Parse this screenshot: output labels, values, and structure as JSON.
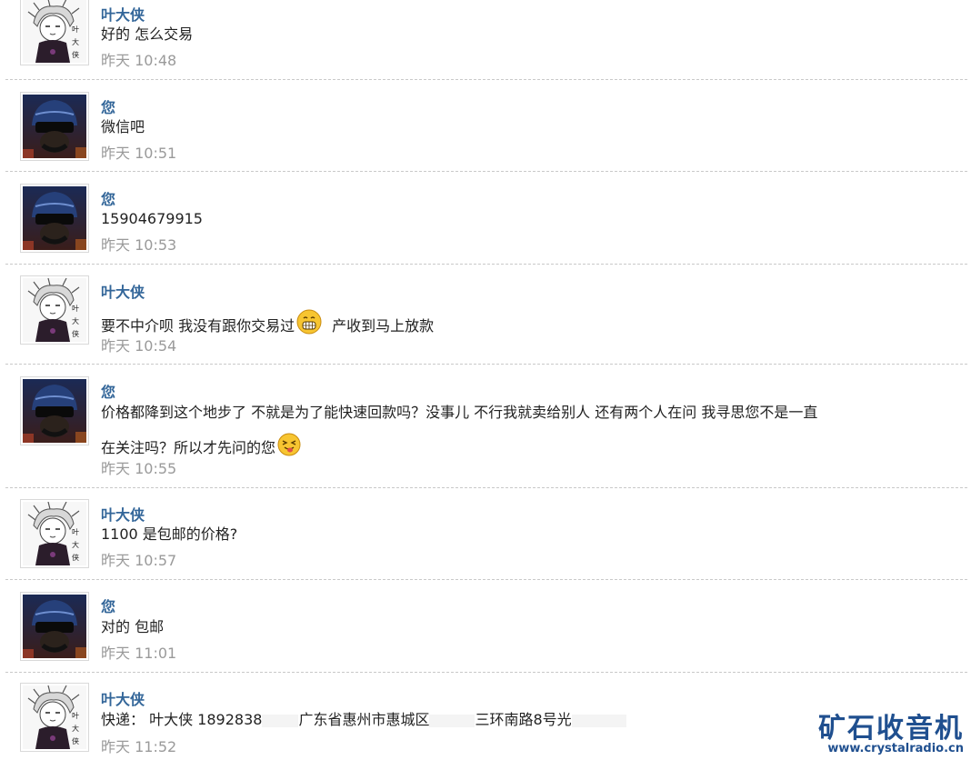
{
  "messages": [
    {
      "author": "叶大侠",
      "avatar": "manga-avatar",
      "text": "好的 怎么交易",
      "time": "昨天 10:48"
    },
    {
      "author": "您",
      "avatar": "helmet-avatar",
      "text": "微信吧",
      "time": "昨天 10:51"
    },
    {
      "author": "您",
      "avatar": "helmet-avatar",
      "text": "15904679915",
      "time": "昨天 10:53"
    },
    {
      "author": "叶大侠",
      "avatar": "manga-avatar",
      "text_a": "要不中介呗  我没有跟你交易过",
      "text_b": " 产收到马上放款",
      "time": "昨天 10:54"
    },
    {
      "author": "您",
      "avatar": "helmet-avatar",
      "line1": "价格都降到这个地步了  不就是为了能快速回款吗？没事儿  不行我就卖给别人  还有两个人在问  我寻思您不是一直",
      "line2": "在关注吗？所以才先问的您",
      "time": "昨天 10:55"
    },
    {
      "author": "叶大侠",
      "avatar": "manga-avatar",
      "text": "1100 是包邮的价格?",
      "time": "昨天 10:57"
    },
    {
      "author": "您",
      "avatar": "helmet-avatar",
      "text": "对的  包邮",
      "time": "昨天 11:01"
    },
    {
      "author": "叶大侠",
      "avatar": "manga-avatar",
      "text_a": "快递：  叶大侠  1892838",
      "text_b": "广东省惠州市惠城区",
      "text_c": "三环南路8号光",
      "time": "昨天 11:52"
    }
  ],
  "emojis": {
    "grin": "grin-emoji",
    "wink": "tongue-emoji"
  },
  "watermark": {
    "title": "矿石收音机",
    "url": "www.crystalradio.cn"
  },
  "colors": {
    "author": "#336699",
    "time": "#9a9a9a",
    "watermark": "#1f4f8f"
  }
}
